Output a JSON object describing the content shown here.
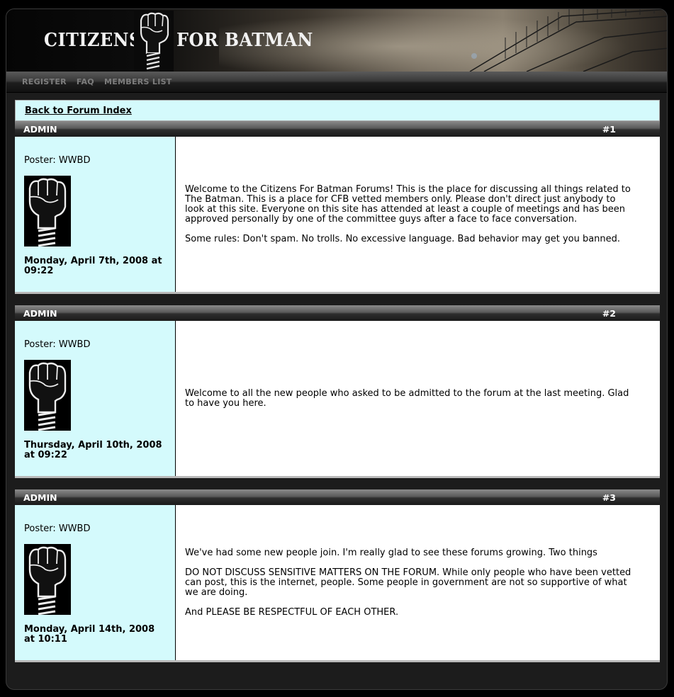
{
  "header": {
    "logo_left": "CITIZENS",
    "logo_right": "FOR BATMAN"
  },
  "nav": {
    "items": [
      {
        "label": "REGISTER"
      },
      {
        "label": "FAQ"
      },
      {
        "label": "MEMBERS LIST"
      }
    ]
  },
  "back_link": "Back to Forum Index",
  "posts": [
    {
      "author": "ADMIN",
      "number": "#1",
      "poster": "Poster: WWBD",
      "date": "Monday, April 7th, 2008 at 09:22",
      "paragraphs": [
        "Welcome to the Citizens For Batman Forums! This is the place for discussing all things related to The Batman. This is a place for CFB vetted members only. Please don't direct just anybody to look at this site. Everyone on this site has attended at least a couple of meetings and has been approved personally by one of the committee guys after a face to face conversation.",
        "Some rules: Don't spam. No trolls. No excessive language. Bad behavior may get you banned."
      ]
    },
    {
      "author": "ADMIN",
      "number": "#2",
      "poster": "Poster: WWBD",
      "date": "Thursday, April 10th, 2008 at 09:22",
      "paragraphs": [
        "Welcome to all the new people who asked to be admitted to the forum at the last meeting. Glad to have you here."
      ]
    },
    {
      "author": "ADMIN",
      "number": "#3",
      "poster": "Poster: WWBD",
      "date": "Monday, April 14th, 2008 at 10:11",
      "paragraphs": [
        "We've had some new people join. I'm really glad to see these forums growing. Two things",
        "DO NOT DISCUSS SENSITIVE MATTERS ON THE FORUM. While only people who have been vetted can post, this is the internet, people. Some people in government are not so supportive of what we are doing.",
        "And PLEASE BE RESPECTFUL OF EACH OTHER."
      ]
    }
  ],
  "colors": {
    "side_bg": "#d4fafc",
    "nav_text": "#7d7d7d"
  }
}
